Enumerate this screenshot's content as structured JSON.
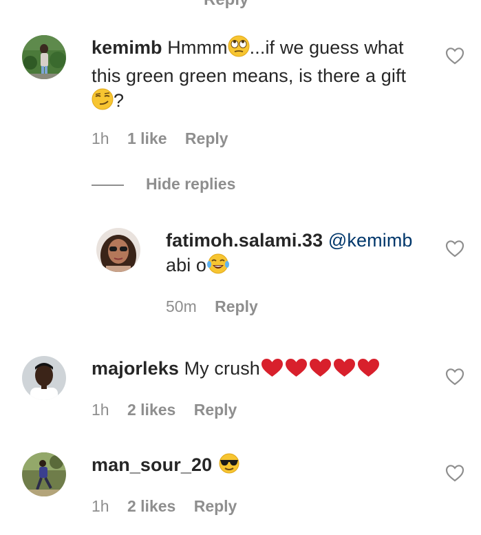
{
  "top_cut_label": "Reply",
  "comments": [
    {
      "username": "kemimb",
      "text_part1": "Hmmm",
      "text_part2": "...if we guess what this green green means, is there a gift",
      "text_part3": "?",
      "time": "1h",
      "likes": "1 like",
      "reply_label": "Reply"
    },
    {
      "username": "fatimoh.salami.33",
      "mention": "@kemimb",
      "text": "abi o",
      "time": "50m",
      "reply_label": "Reply"
    },
    {
      "username": "majorleks",
      "text": "My crush",
      "time": "1h",
      "likes": "2 likes",
      "reply_label": "Reply"
    },
    {
      "username": "man_sour_20",
      "time": "1h",
      "likes": "2 likes",
      "reply_label": "Reply"
    }
  ],
  "hide_replies_label": "Hide replies",
  "icons": {
    "like": "heart-outline-icon",
    "eye_roll": "eye-roll-emoji",
    "smirk": "smirk-emoji",
    "laugh": "tears-of-joy-emoji",
    "heart": "red-heart-emoji",
    "sunglasses": "sunglasses-emoji"
  },
  "colors": {
    "text": "#262626",
    "secondary": "#8e8e8e",
    "mention": "#00376b",
    "heart_red": "#d8202c",
    "emoji_yellow": "#f7c531"
  }
}
